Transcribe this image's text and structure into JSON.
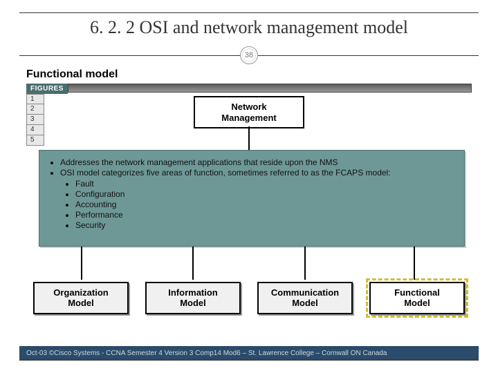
{
  "title": "6. 2. 2  OSI and network management model",
  "slide_number": "38",
  "section_label": "Functional model",
  "figures_tab": "FIGURES",
  "figure_numbers": [
    "1",
    "2",
    "3",
    "4",
    "5"
  ],
  "top_box": {
    "line1": "Network",
    "line2": "Management"
  },
  "bullets": {
    "b1": "Addresses the network management applications that reside upon the NMS",
    "b2": "OSI model categorizes five areas of function, sometimes referred to as the FCAPS model:",
    "sub": [
      "Fault",
      "Configuration",
      "Accounting",
      "Performance",
      "Security"
    ]
  },
  "bottom_boxes": [
    {
      "line1": "Organization",
      "line2": "Model"
    },
    {
      "line1": "Information",
      "line2": "Model"
    },
    {
      "line1": "Communication",
      "line2": "Model"
    },
    {
      "line1": "Functional",
      "line2": "Model"
    }
  ],
  "highlighted_box_index": 3,
  "footer": "Oct-03 ©Cisco Systems - CCNA Semester 4 Version 3 Comp14 Mod6 – St. Lawrence College – Cornwall ON Canada",
  "chart_data": {
    "type": "diagram",
    "title": "Functional model",
    "root": "Network Management",
    "children": [
      "Organization Model",
      "Information Model",
      "Communication Model",
      "Functional Model"
    ],
    "highlighted": "Functional Model",
    "fcaps": [
      "Fault",
      "Configuration",
      "Accounting",
      "Performance",
      "Security"
    ],
    "description_bullets": [
      "Addresses the network management applications that reside upon the NMS",
      "OSI model categorizes five areas of function, sometimes referred to as the FCAPS model:"
    ]
  }
}
